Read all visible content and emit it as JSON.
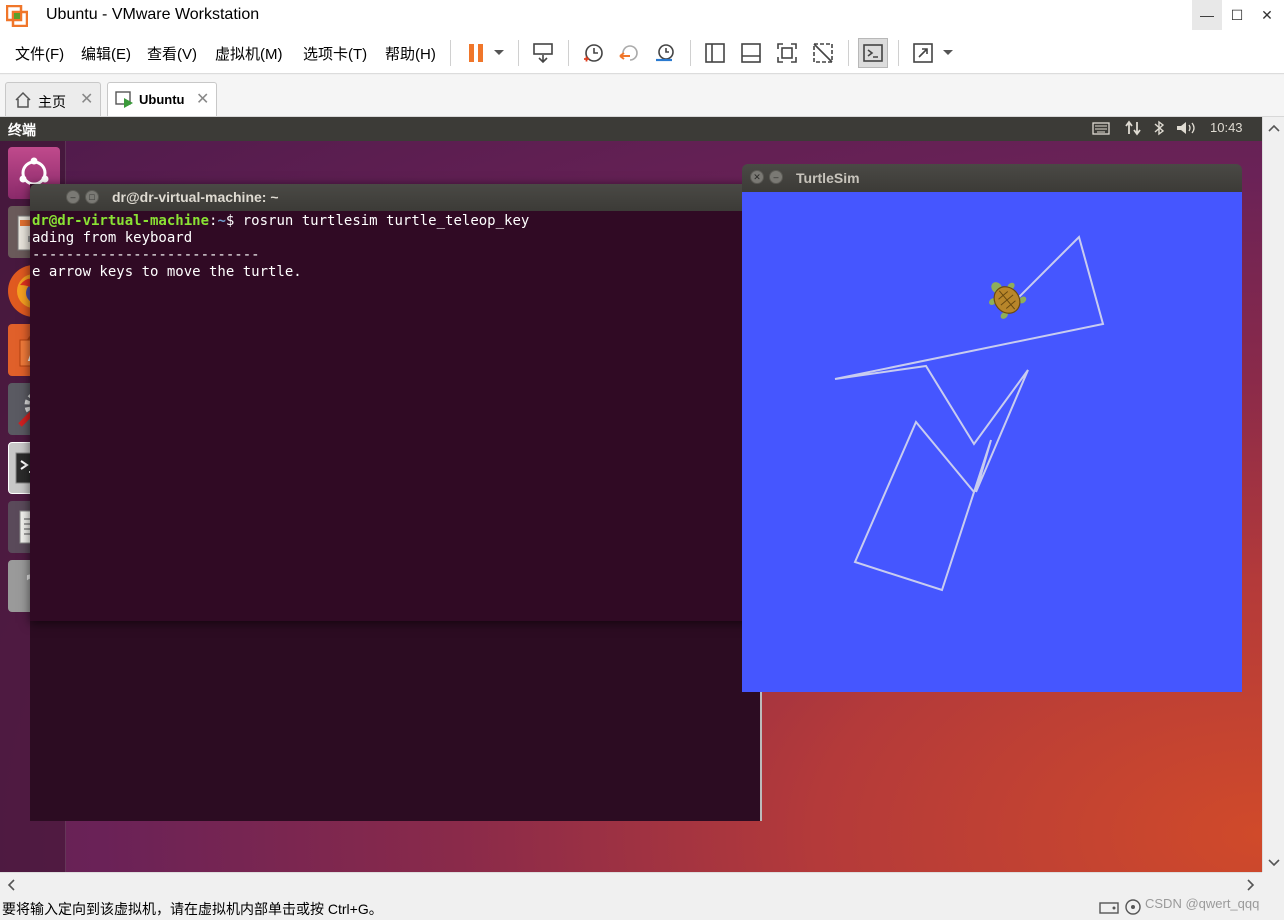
{
  "window": {
    "title": "Ubuntu - VMware Workstation",
    "controls": {
      "minimize": "—",
      "maximize": "☐",
      "close": "✕"
    }
  },
  "menu": [
    "文件(F)",
    "编辑(E)",
    "查看(V)",
    "虚拟机(M)",
    "选项卡(T)",
    "帮助(H)"
  ],
  "toolbar": {
    "icons": [
      "pause-icon",
      "dropdown-arrow-icon",
      "send-ctrl-alt-del-icon",
      "snapshot-take-icon",
      "snapshot-revert-icon",
      "snapshot-manager-icon",
      "library-view-icon",
      "thumbnail-bar-icon",
      "fullscreen-icon",
      "unity-icon",
      "console-view-icon",
      "stretch-icon",
      "dropdown-arrow-icon"
    ],
    "accent": "#f0762a"
  },
  "tabs": [
    {
      "label": "主页",
      "icon": "home-icon"
    },
    {
      "label": "Ubuntu",
      "icon": "vm-running-icon",
      "active": true
    }
  ],
  "guest": {
    "topbar": {
      "title": "终端",
      "clock": "10:43"
    },
    "launcher": [
      "ubuntu-dash-icon",
      "files-icon",
      "firefox-icon",
      "software-center-icon",
      "system-settings-icon",
      "terminal-icon",
      "text-editor-icon",
      "help-icon"
    ],
    "terminal": {
      "title": "dr@dr-virtual-machine: ~",
      "prompt_user": "dr@dr-virtual-machine",
      "prompt_path": "~",
      "command": "$ rosrun turtlesim turtle_teleop_key",
      "lines": [
        "ading from keyboard",
        "---------------------------",
        "e arrow keys to move the turtle."
      ]
    },
    "turtlesim": {
      "title": "TurtleSim",
      "background": "#4556ff",
      "trail_color": "#c8ccf0"
    }
  },
  "statusbar": {
    "text": "要将输入定向到该虚拟机，请在虚拟机内部单击或按 Ctrl+G。",
    "watermark": "CSDN @qwert_qqq"
  }
}
